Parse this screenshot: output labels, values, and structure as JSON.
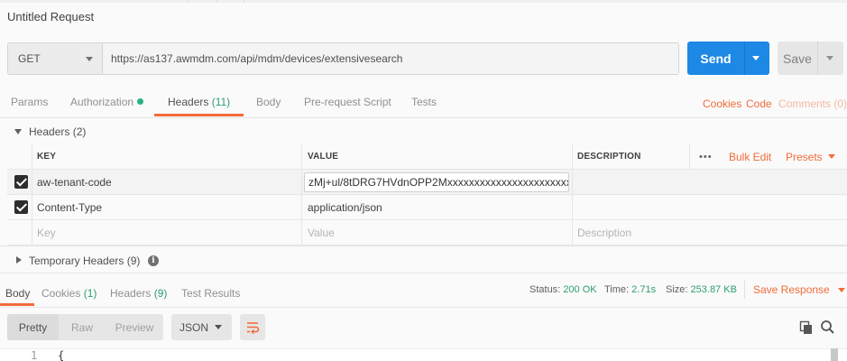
{
  "request": {
    "title": "Untitled Request",
    "method": "GET",
    "url": "https://as137.awmdm.com/api/mdm/devices/extensivesearch",
    "send_label": "Send",
    "save_label": "Save"
  },
  "tabs": [
    {
      "label": "Params",
      "count": ""
    },
    {
      "label": "Authorization",
      "count": ""
    },
    {
      "label": "Headers",
      "count": "(11)"
    },
    {
      "label": "Body",
      "count": ""
    },
    {
      "label": "Pre-request Script",
      "count": ""
    },
    {
      "label": "Tests",
      "count": ""
    }
  ],
  "right_links": {
    "cookies": "Cookies",
    "code": "Code",
    "comments": "Comments (0)"
  },
  "headers_section": {
    "label": "Headers",
    "count": "(2)"
  },
  "table": {
    "col_key": "KEY",
    "col_value": "VALUE",
    "col_description": "DESCRIPTION",
    "more": "•••",
    "bulk_edit": "Bulk Edit",
    "presets": "Presets",
    "rows": [
      {
        "key": "aw-tenant-code",
        "value": "zMj+ul/8tDRG7HVdnOPP2Mxxxxxxxxxxxxxxxxxxxxxxxx",
        "checked": true
      },
      {
        "key": "Content-Type",
        "value": "application/json",
        "checked": true
      }
    ],
    "placeholder": {
      "key": "Key",
      "value": "Value",
      "description": "Description"
    }
  },
  "temp_headers": {
    "label": "Temporary Headers",
    "count": "(9)",
    "info": "i"
  },
  "response": {
    "tabs": [
      {
        "label": "Body",
        "count": ""
      },
      {
        "label": "Cookies",
        "count": "(1)"
      },
      {
        "label": "Headers",
        "count": "(9)"
      },
      {
        "label": "Test Results",
        "count": ""
      }
    ],
    "status_label": "Status:",
    "status_value": "200 OK",
    "time_label": "Time:",
    "time_value": "2.71s",
    "size_label": "Size:",
    "size_value": "253.87 KB",
    "save_response": "Save Response"
  },
  "body_toolbar": {
    "modes": [
      "Pretty",
      "Raw",
      "Preview"
    ],
    "format": "JSON"
  },
  "editor": {
    "line": "1",
    "code": "{"
  },
  "colors": {
    "accent": "#f26b3a",
    "send": "#1e88e5",
    "count": "#2d9e6d"
  }
}
